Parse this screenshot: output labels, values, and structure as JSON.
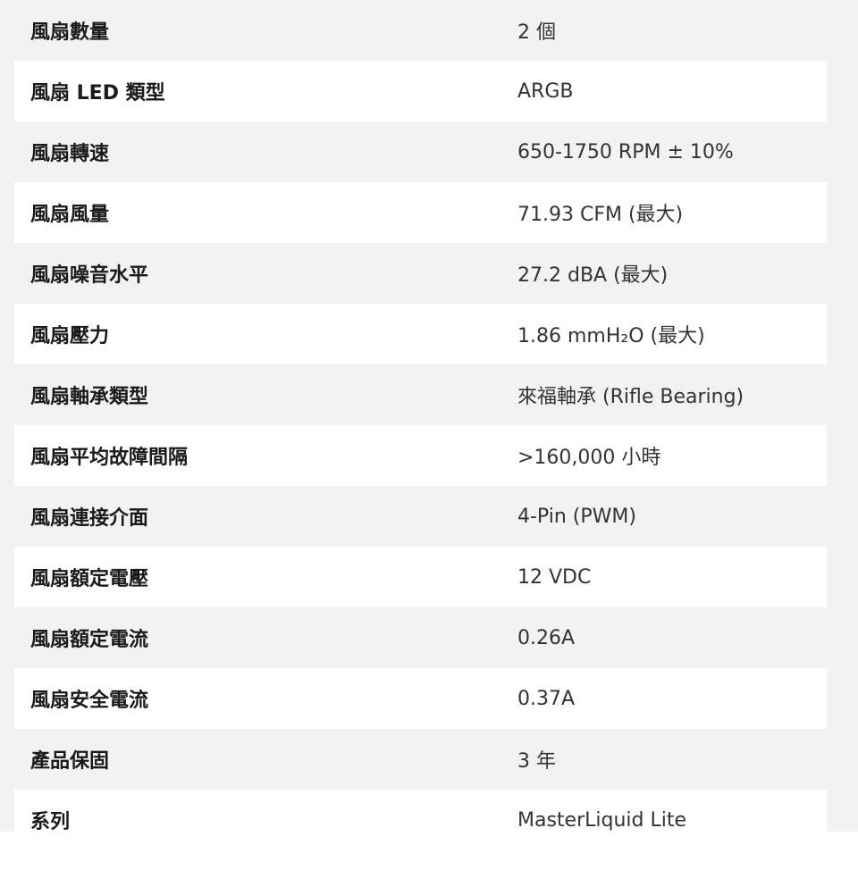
{
  "specs": [
    {
      "label": "風扇數量",
      "value": "2 個"
    },
    {
      "label": "風扇 LED 類型",
      "value": "ARGB"
    },
    {
      "label": "風扇轉速",
      "value": "650-1750 RPM ± 10%"
    },
    {
      "label": "風扇風量",
      "value": "71.93 CFM (最大)"
    },
    {
      "label": "風扇噪音水平",
      "value": "27.2 dBA (最大)"
    },
    {
      "label": "風扇壓力",
      "value": "1.86 mmH₂O (最大)"
    },
    {
      "label": "風扇軸承類型",
      "value": "來福軸承 (Rifle Bearing)"
    },
    {
      "label": "風扇平均故障間隔",
      "value": ">160,000 小時"
    },
    {
      "label": "風扇連接介面",
      "value": "4-Pin (PWM)"
    },
    {
      "label": "風扇額定電壓",
      "value": "12 VDC"
    },
    {
      "label": "風扇額定電流",
      "value": "0.26A"
    },
    {
      "label": "風扇安全電流",
      "value": "0.37A"
    },
    {
      "label": "產品保固",
      "value": "3 年"
    },
    {
      "label": "系列",
      "value": "MasterLiquid Lite"
    }
  ]
}
